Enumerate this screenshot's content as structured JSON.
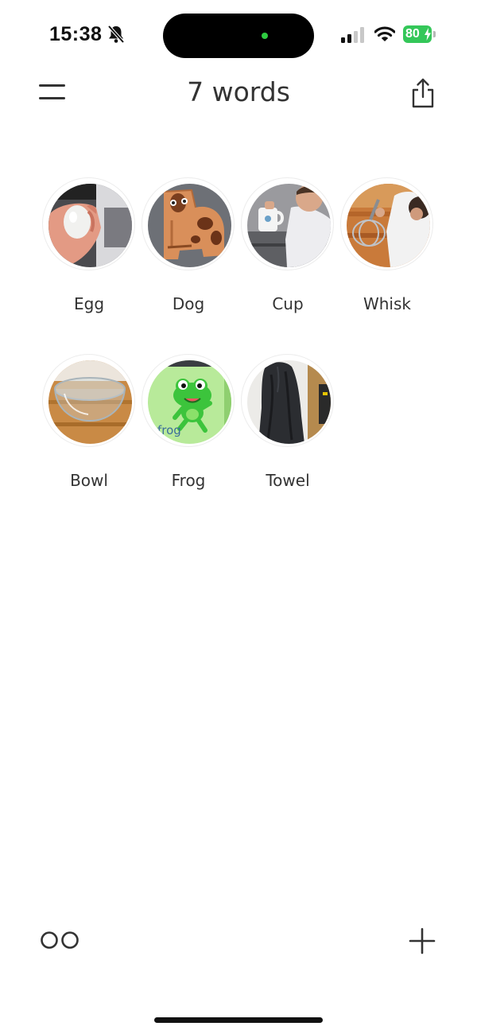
{
  "status_bar": {
    "time": "15:38",
    "battery_level": "80",
    "cellular_bars_filled": 2,
    "cellular_bars_total": 4,
    "icons": [
      "bell-off-icon",
      "signal-icon",
      "wifi-icon",
      "battery-icon",
      "charging-bolt-icon"
    ]
  },
  "header": {
    "title": "7 words",
    "menu_icon": "hamburger-menu-icon",
    "share_icon": "share-icon"
  },
  "words": [
    {
      "label": "Egg",
      "photo": "egg-photo"
    },
    {
      "label": "Dog",
      "photo": "dog-photo"
    },
    {
      "label": "Cup",
      "photo": "cup-photo"
    },
    {
      "label": "Whisk",
      "photo": "whisk-photo"
    },
    {
      "label": "Bowl",
      "photo": "bowl-photo"
    },
    {
      "label": "Frog",
      "photo": "frog-photo",
      "photo_text": "frog"
    },
    {
      "label": "Towel",
      "photo": "towel-photo"
    }
  ],
  "bottom_bar": {
    "left_icon": "glasses-icon",
    "right_icon": "plus-icon"
  },
  "colors": {
    "text": "#333333",
    "battery": "#34c759",
    "island_indicator": "#2ecc40",
    "frog_green": "#3cc43c",
    "frog_bg": "#b8ea9a"
  }
}
